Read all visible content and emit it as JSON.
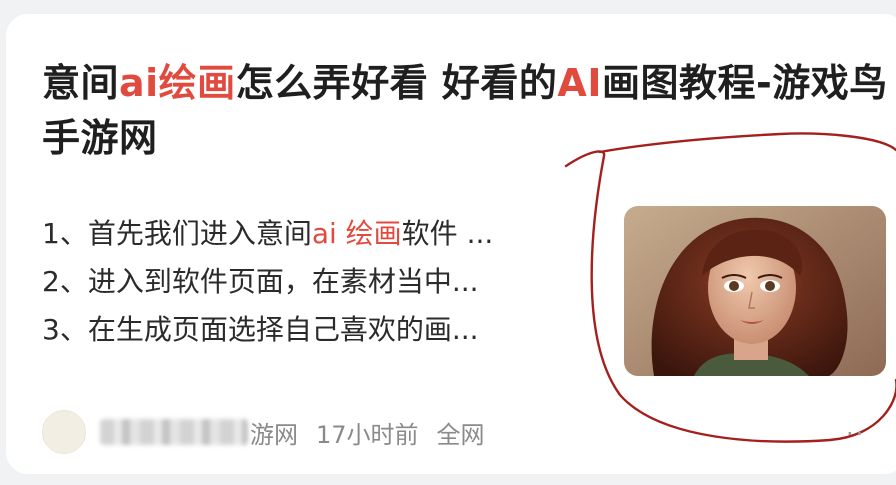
{
  "result": {
    "title": {
      "part1": "意间",
      "hl1": "ai绘画",
      "part2": "怎么弄好看 好看的",
      "hl2": "AI",
      "part3": "画图教程-游戏鸟手游网"
    },
    "steps": [
      {
        "prefix": "1、首先我们进入意间",
        "highlight": "ai 绘画",
        "suffix": "软件 ..."
      },
      {
        "text": "2、进入到软件页面，在素材当中..."
      },
      {
        "text": "3、在生成页面选择自己喜欢的画..."
      }
    ],
    "meta": {
      "source_suffix": "游网",
      "time": "17小时前",
      "scope": "全网"
    },
    "more_glyph": "··"
  },
  "colors": {
    "highlight": "#e14b3f",
    "annotation_circle": "#a3201d"
  }
}
